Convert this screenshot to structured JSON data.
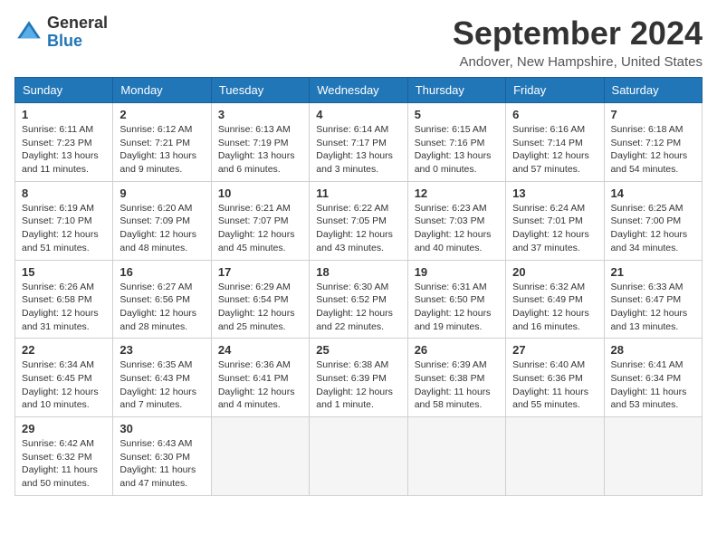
{
  "logo": {
    "line1": "General",
    "line2": "Blue"
  },
  "title": "September 2024",
  "subtitle": "Andover, New Hampshire, United States",
  "weekdays": [
    "Sunday",
    "Monday",
    "Tuesday",
    "Wednesday",
    "Thursday",
    "Friday",
    "Saturday"
  ],
  "weeks": [
    [
      {
        "day": "1",
        "sunrise": "6:11 AM",
        "sunset": "7:23 PM",
        "daylight": "13 hours and 11 minutes."
      },
      {
        "day": "2",
        "sunrise": "6:12 AM",
        "sunset": "7:21 PM",
        "daylight": "13 hours and 9 minutes."
      },
      {
        "day": "3",
        "sunrise": "6:13 AM",
        "sunset": "7:19 PM",
        "daylight": "13 hours and 6 minutes."
      },
      {
        "day": "4",
        "sunrise": "6:14 AM",
        "sunset": "7:17 PM",
        "daylight": "13 hours and 3 minutes."
      },
      {
        "day": "5",
        "sunrise": "6:15 AM",
        "sunset": "7:16 PM",
        "daylight": "13 hours and 0 minutes."
      },
      {
        "day": "6",
        "sunrise": "6:16 AM",
        "sunset": "7:14 PM",
        "daylight": "12 hours and 57 minutes."
      },
      {
        "day": "7",
        "sunrise": "6:18 AM",
        "sunset": "7:12 PM",
        "daylight": "12 hours and 54 minutes."
      }
    ],
    [
      {
        "day": "8",
        "sunrise": "6:19 AM",
        "sunset": "7:10 PM",
        "daylight": "12 hours and 51 minutes."
      },
      {
        "day": "9",
        "sunrise": "6:20 AM",
        "sunset": "7:09 PM",
        "daylight": "12 hours and 48 minutes."
      },
      {
        "day": "10",
        "sunrise": "6:21 AM",
        "sunset": "7:07 PM",
        "daylight": "12 hours and 45 minutes."
      },
      {
        "day": "11",
        "sunrise": "6:22 AM",
        "sunset": "7:05 PM",
        "daylight": "12 hours and 43 minutes."
      },
      {
        "day": "12",
        "sunrise": "6:23 AM",
        "sunset": "7:03 PM",
        "daylight": "12 hours and 40 minutes."
      },
      {
        "day": "13",
        "sunrise": "6:24 AM",
        "sunset": "7:01 PM",
        "daylight": "12 hours and 37 minutes."
      },
      {
        "day": "14",
        "sunrise": "6:25 AM",
        "sunset": "7:00 PM",
        "daylight": "12 hours and 34 minutes."
      }
    ],
    [
      {
        "day": "15",
        "sunrise": "6:26 AM",
        "sunset": "6:58 PM",
        "daylight": "12 hours and 31 minutes."
      },
      {
        "day": "16",
        "sunrise": "6:27 AM",
        "sunset": "6:56 PM",
        "daylight": "12 hours and 28 minutes."
      },
      {
        "day": "17",
        "sunrise": "6:29 AM",
        "sunset": "6:54 PM",
        "daylight": "12 hours and 25 minutes."
      },
      {
        "day": "18",
        "sunrise": "6:30 AM",
        "sunset": "6:52 PM",
        "daylight": "12 hours and 22 minutes."
      },
      {
        "day": "19",
        "sunrise": "6:31 AM",
        "sunset": "6:50 PM",
        "daylight": "12 hours and 19 minutes."
      },
      {
        "day": "20",
        "sunrise": "6:32 AM",
        "sunset": "6:49 PM",
        "daylight": "12 hours and 16 minutes."
      },
      {
        "day": "21",
        "sunrise": "6:33 AM",
        "sunset": "6:47 PM",
        "daylight": "12 hours and 13 minutes."
      }
    ],
    [
      {
        "day": "22",
        "sunrise": "6:34 AM",
        "sunset": "6:45 PM",
        "daylight": "12 hours and 10 minutes."
      },
      {
        "day": "23",
        "sunrise": "6:35 AM",
        "sunset": "6:43 PM",
        "daylight": "12 hours and 7 minutes."
      },
      {
        "day": "24",
        "sunrise": "6:36 AM",
        "sunset": "6:41 PM",
        "daylight": "12 hours and 4 minutes."
      },
      {
        "day": "25",
        "sunrise": "6:38 AM",
        "sunset": "6:39 PM",
        "daylight": "12 hours and 1 minute."
      },
      {
        "day": "26",
        "sunrise": "6:39 AM",
        "sunset": "6:38 PM",
        "daylight": "11 hours and 58 minutes."
      },
      {
        "day": "27",
        "sunrise": "6:40 AM",
        "sunset": "6:36 PM",
        "daylight": "11 hours and 55 minutes."
      },
      {
        "day": "28",
        "sunrise": "6:41 AM",
        "sunset": "6:34 PM",
        "daylight": "11 hours and 53 minutes."
      }
    ],
    [
      {
        "day": "29",
        "sunrise": "6:42 AM",
        "sunset": "6:32 PM",
        "daylight": "11 hours and 50 minutes."
      },
      {
        "day": "30",
        "sunrise": "6:43 AM",
        "sunset": "6:30 PM",
        "daylight": "11 hours and 47 minutes."
      },
      null,
      null,
      null,
      null,
      null
    ]
  ],
  "labels": {
    "sunrise": "Sunrise:",
    "sunset": "Sunset:",
    "daylight": "Daylight:"
  }
}
